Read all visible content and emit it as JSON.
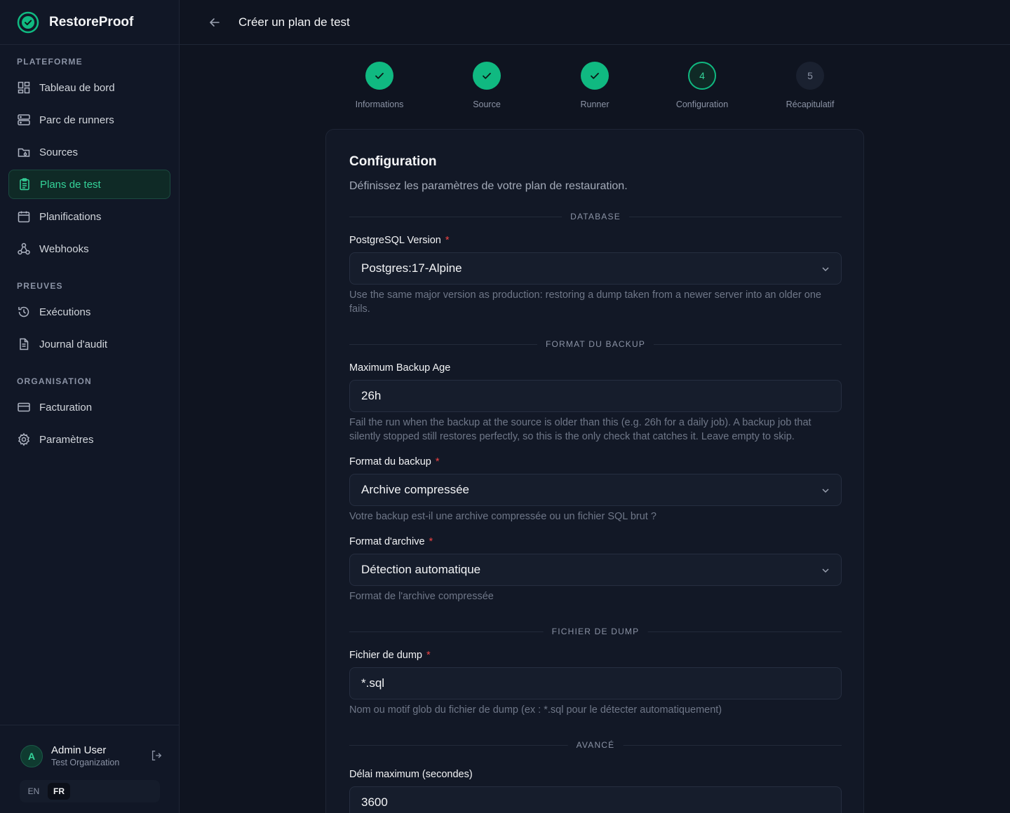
{
  "brand": {
    "name": "RestoreProof"
  },
  "header": {
    "title": "Créer un plan de test"
  },
  "sidebar": {
    "sections": [
      {
        "label": "PLATEFORME"
      },
      {
        "label": "PREUVES"
      },
      {
        "label": "ORGANISATION"
      }
    ],
    "items": [
      {
        "label": "Tableau de bord",
        "icon": "dashboard-icon"
      },
      {
        "label": "Parc de runners",
        "icon": "server-icon"
      },
      {
        "label": "Sources",
        "icon": "folder-icon"
      },
      {
        "label": "Plans de test",
        "icon": "clipboard-icon",
        "active": true
      },
      {
        "label": "Planifications",
        "icon": "calendar-icon"
      },
      {
        "label": "Webhooks",
        "icon": "webhook-icon"
      },
      {
        "label": "Exécutions",
        "icon": "history-icon"
      },
      {
        "label": "Journal d'audit",
        "icon": "document-icon"
      },
      {
        "label": "Facturation",
        "icon": "credit-card-icon"
      },
      {
        "label": "Paramètres",
        "icon": "gear-icon"
      }
    ],
    "user": {
      "initial": "A",
      "name": "Admin User",
      "org": "Test Organization"
    },
    "languages": [
      {
        "label": "EN"
      },
      {
        "label": "FR",
        "active": true
      }
    ]
  },
  "stepper": [
    {
      "label": "Informations",
      "state": "done"
    },
    {
      "label": "Source",
      "state": "done"
    },
    {
      "label": "Runner",
      "state": "done"
    },
    {
      "label": "Configuration",
      "number": "4",
      "state": "current"
    },
    {
      "label": "Récapitulatif",
      "number": "5",
      "state": "todo"
    }
  ],
  "form": {
    "title": "Configuration",
    "subtitle": "Définissez les paramètres de votre plan de restauration.",
    "sections": {
      "database": "DATABASE",
      "backup_format": "FORMAT DU BACKUP",
      "dump_file": "FICHIER DE DUMP",
      "advanced": "AVANCÉ"
    },
    "fields": {
      "pg_version": {
        "label": "PostgreSQL Version",
        "required": "*",
        "value": "Postgres:17-Alpine",
        "help": "Use the same major version as production: restoring a dump taken from a newer server into an older one fails."
      },
      "max_age": {
        "label": "Maximum Backup Age",
        "value": "26h",
        "help": "Fail the run when the backup at the source is older than this (e.g. 26h for a daily job). A backup job that silently stopped still restores perfectly, so this is the only check that catches it. Leave empty to skip."
      },
      "backup_format": {
        "label": "Format du backup",
        "required": "*",
        "value": "Archive compressée",
        "help": "Votre backup est-il une archive compressée ou un fichier SQL brut ?"
      },
      "archive_format": {
        "label": "Format d'archive",
        "required": "*",
        "value": "Détection automatique",
        "help": "Format de l'archive compressée"
      },
      "dump_file": {
        "label": "Fichier de dump",
        "required": "*",
        "value": "*.sql",
        "help": "Nom ou motif glob du fichier de dump (ex : *.sql pour le détecter automatiquement)"
      },
      "timeout": {
        "label": "Délai maximum (secondes)",
        "value": "3600"
      }
    }
  },
  "colors": {
    "accent": "#10b981",
    "background": "#0f1420",
    "required": "#ef4444"
  }
}
